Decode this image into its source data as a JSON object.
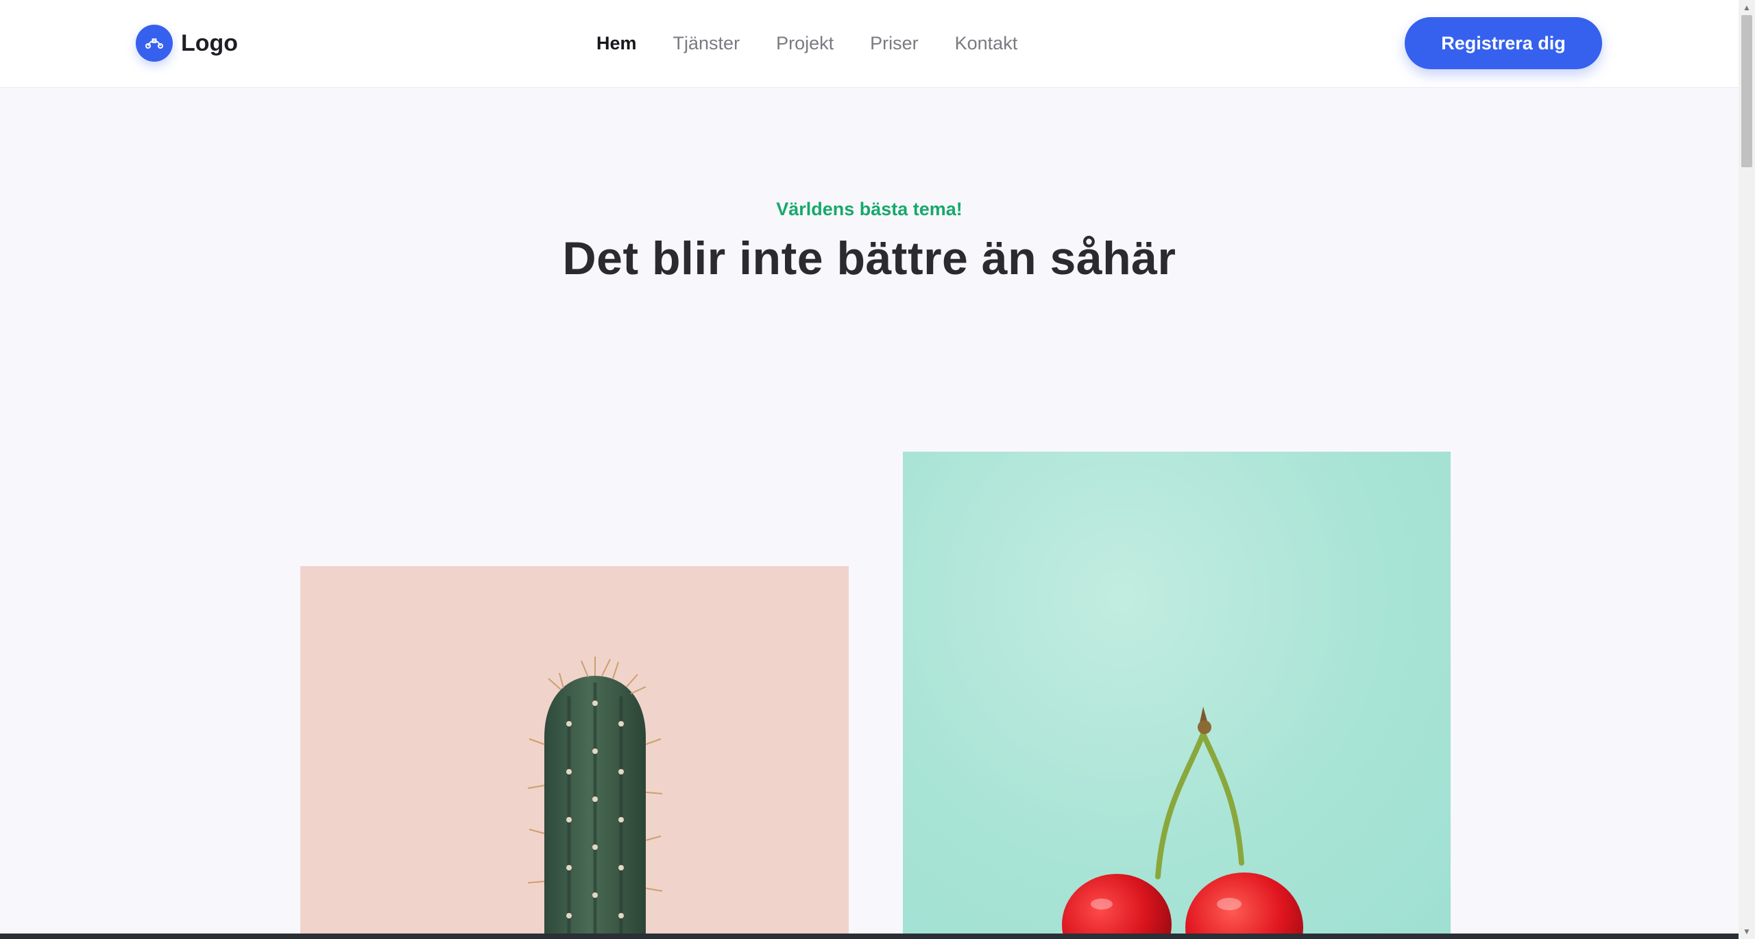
{
  "header": {
    "logo_text": "Logo",
    "logo_icon": "bezier-curve-icon",
    "nav": [
      {
        "label": "Hem",
        "active": true
      },
      {
        "label": "Tjänster",
        "active": false
      },
      {
        "label": "Projekt",
        "active": false
      },
      {
        "label": "Priser",
        "active": false
      },
      {
        "label": "Kontakt",
        "active": false
      }
    ],
    "cta_label": "Registrera dig"
  },
  "hero": {
    "eyebrow": "Världens bästa tema!",
    "headline": "Det blir inte bättre än såhär"
  },
  "gallery": [
    {
      "subject": "cactus",
      "background": "#f0d3cb"
    },
    {
      "subject": "cherries",
      "background": "#a9e4d6"
    }
  ],
  "colors": {
    "accent": "#3661ee",
    "eyebrow": "#16a96a",
    "page_background": "#f8f7fc"
  }
}
